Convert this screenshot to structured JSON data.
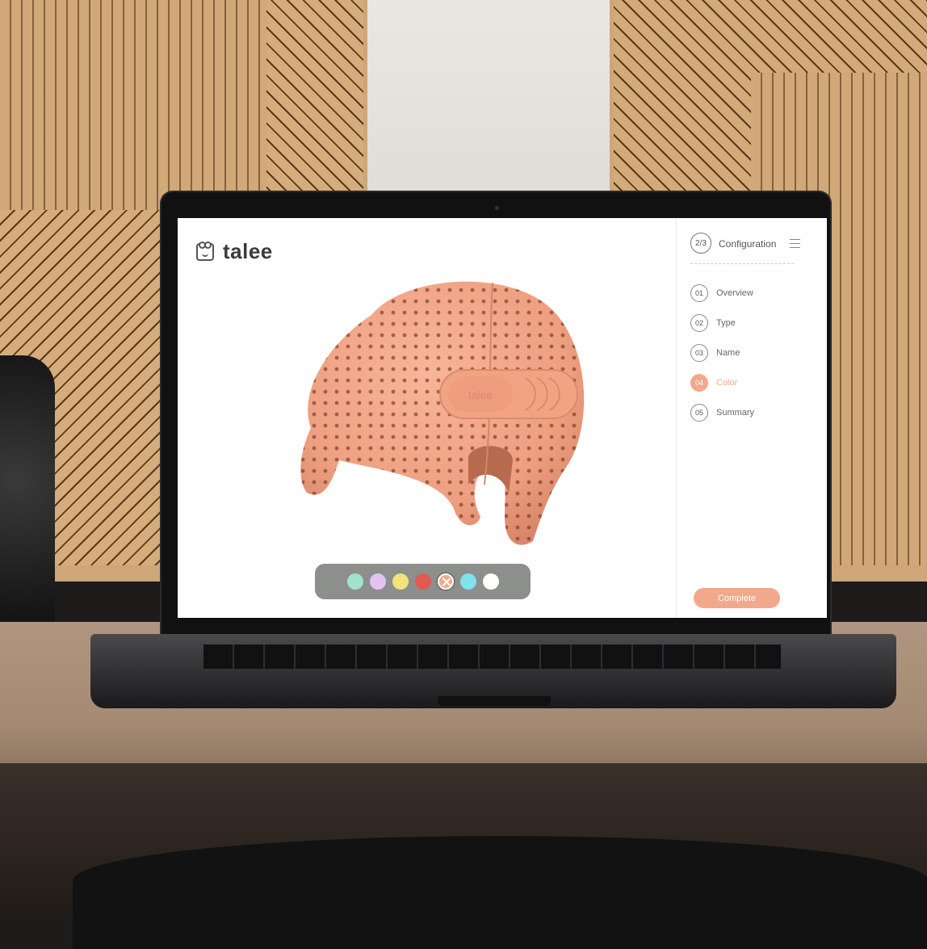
{
  "app": {
    "logo_text": "talee",
    "logo_icon": "bear-icon"
  },
  "product": {
    "brand_label": "talee",
    "color": "#f2a98b"
  },
  "color_picker": {
    "swatches": [
      {
        "name": "mint",
        "color": "#9fe3d0"
      },
      {
        "name": "lavender",
        "color": "#e4c2f2"
      },
      {
        "name": "yellow",
        "color": "#f4e27a"
      },
      {
        "name": "red",
        "color": "#e05a52"
      },
      {
        "name": "peach",
        "color": "#f2a98b",
        "selected": true
      },
      {
        "name": "cyan",
        "color": "#7fe3ec"
      },
      {
        "name": "white",
        "color": "#ffffff"
      }
    ]
  },
  "sidebar": {
    "progress": "2/3",
    "title": "Configuration",
    "steps": [
      {
        "num": "01",
        "label": "Overview"
      },
      {
        "num": "02",
        "label": "Type"
      },
      {
        "num": "03",
        "label": "Name"
      },
      {
        "num": "04",
        "label": "Color",
        "active": true
      },
      {
        "num": "05",
        "label": "Summary"
      }
    ],
    "complete_label": "Complete"
  },
  "colors": {
    "accent": "#f2a98b",
    "picker_bg": "#8c8f8c"
  }
}
